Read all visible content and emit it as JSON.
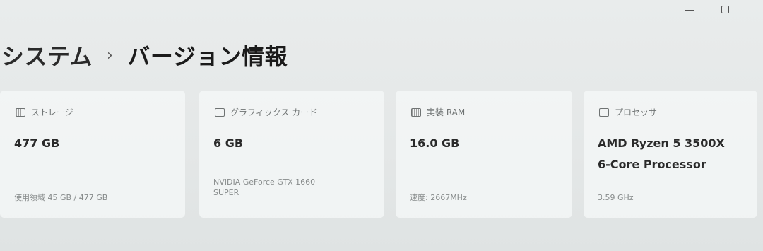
{
  "window": {
    "minimize_icon": "minimize-icon",
    "maximize_icon": "maximize-icon"
  },
  "breadcrumb": {
    "parent": "システム",
    "separator": "›",
    "current": "バージョン情報"
  },
  "cards": {
    "storage": {
      "icon": "storage-icon",
      "label": "ストレージ",
      "value": "477 GB",
      "detail": "使用領域 45 GB / 477 GB"
    },
    "gpu": {
      "icon": "graphics-card-icon",
      "label": "グラフィックス カード",
      "value": "6 GB",
      "detail_line1": "NVIDIA GeForce GTX 1660",
      "detail_line2": "SUPER"
    },
    "ram": {
      "icon": "memory-icon",
      "label": "実装 RAM",
      "value": "16.0 GB",
      "detail": "速度: 2667MHz"
    },
    "cpu": {
      "icon": "processor-icon",
      "label": "プロセッサ",
      "value_line1": "AMD Ryzen 5 3500X",
      "value_line2": "6-Core Processor",
      "detail": "3.59 GHz"
    }
  }
}
